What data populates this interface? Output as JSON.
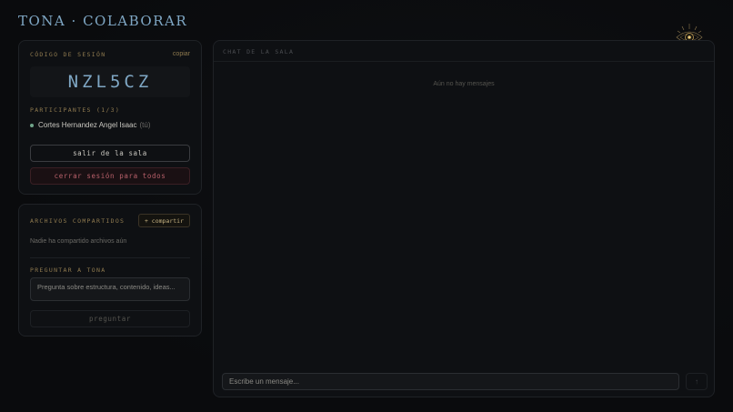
{
  "app": {
    "title": "TONA · COLABORAR"
  },
  "session": {
    "code_label": "CÓDIGO DE SESIÓN",
    "copy_label": "copiar",
    "code": "NZL5CZ",
    "participants_label": "PARTICIPANTES (1/3)",
    "participants": [
      {
        "name": "Cortes Hernandez Angel Isaac",
        "tag": "(tú)",
        "status_color": "#6fa58a"
      }
    ],
    "leave_label": "salir de la sala",
    "close_all_label": "cerrar sesión para todos"
  },
  "files": {
    "label": "ARCHIVOS COMPARTIDOS",
    "share_label": "+ compartir",
    "empty_text": "Nadie ha compartido archivos aún"
  },
  "ask": {
    "label": "PREGUNTAR A TONA",
    "placeholder": "Pregunta sobre estructura, contenido, ideas...",
    "button_label": "preguntar"
  },
  "chat": {
    "header": "CHAT DE LA SALA",
    "empty_text": "Aún no hay mensajes",
    "input_placeholder": "Escribe un mensaje...",
    "send_icon": "↑"
  },
  "colors": {
    "accent_blue": "#7fa7c4",
    "accent_gold": "#8f7a4f",
    "danger": "#b8606a",
    "online": "#6fa58a",
    "background": "#0b0c0e"
  }
}
